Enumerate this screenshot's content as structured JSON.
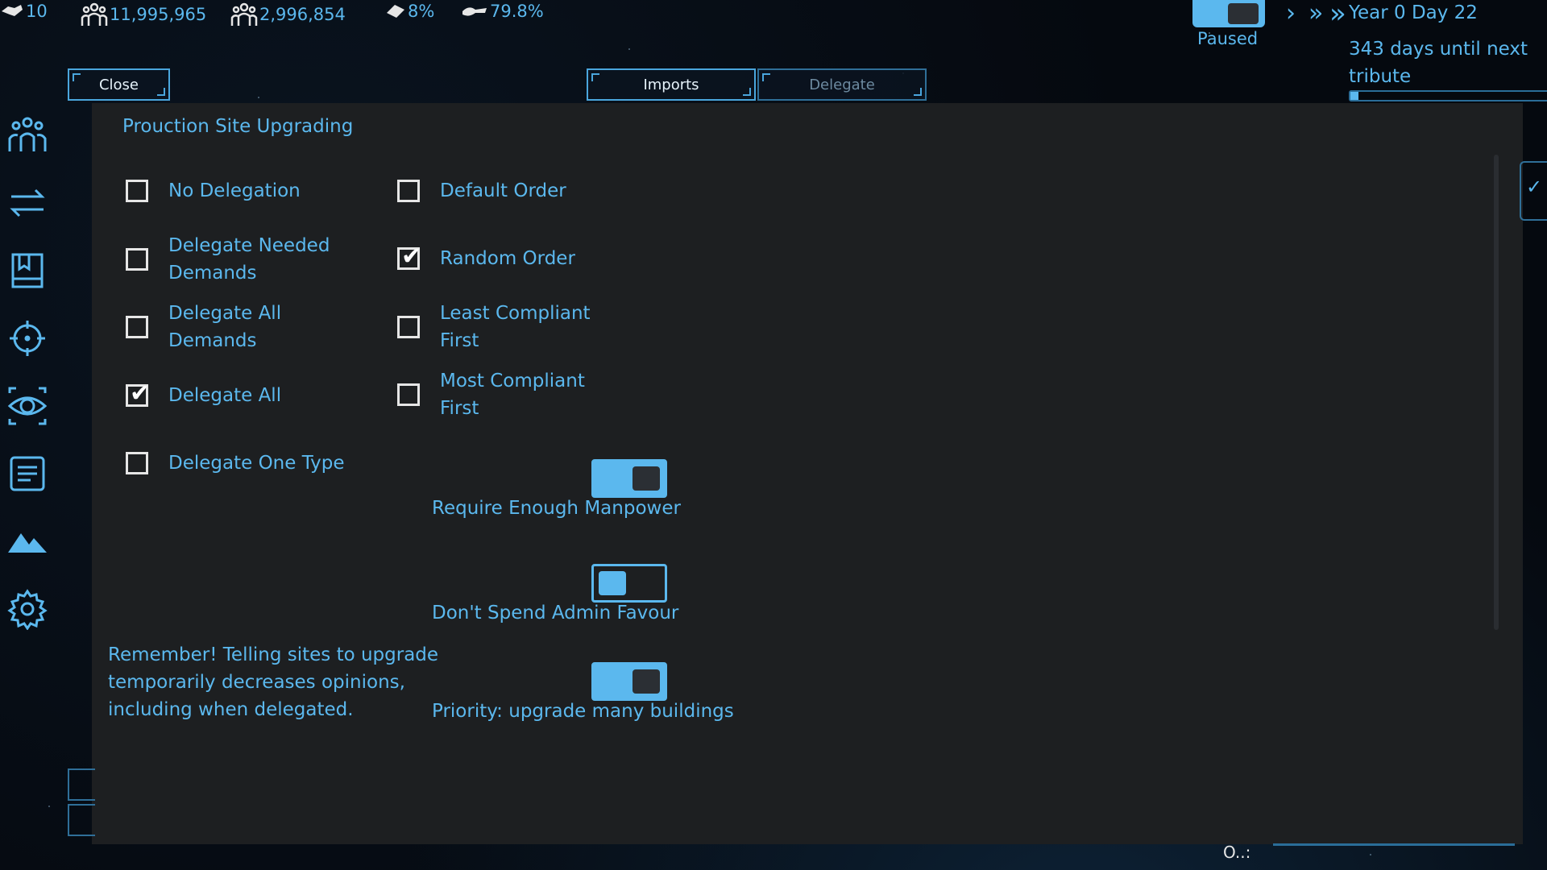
{
  "topbar": {
    "resources": [
      {
        "icon": "handshake-icon",
        "value": "10"
      },
      {
        "icon": "population-icon",
        "value": "11,995,965"
      },
      {
        "icon": "workforce-icon",
        "value": "2,996,854"
      },
      {
        "icon": "growth-icon",
        "value": "8%"
      },
      {
        "icon": "approval-icon",
        "value": "79.8%"
      }
    ],
    "paused_label": "Paused",
    "date": "Year 0 Day 22",
    "tribute": "343 days until next tribute",
    "tribute_progress": 0.04
  },
  "buttons": {
    "close": "Close",
    "imports": "Imports",
    "delegate": "Delegate"
  },
  "sidebar": [
    "people-icon",
    "trade-arrows-icon",
    "book-icon",
    "crosshair-icon",
    "eye-icon",
    "log-icon",
    "mountain-icon",
    "gear-icon"
  ],
  "panel": {
    "title": "Prouction Site Upgrading",
    "left_options": [
      {
        "label": "No Delegation",
        "checked": false
      },
      {
        "label": "Delegate Needed Demands",
        "checked": false
      },
      {
        "label": "Delegate All Demands",
        "checked": false
      },
      {
        "label": "Delegate All",
        "checked": true
      },
      {
        "label": "Delegate One Type",
        "checked": false
      }
    ],
    "right_options": [
      {
        "label": "Default Order",
        "checked": false
      },
      {
        "label": "Random Order",
        "checked": true
      },
      {
        "label": "Least Compliant First",
        "checked": false
      },
      {
        "label": "Most Compliant First",
        "checked": false
      }
    ],
    "toggles": [
      {
        "label": "Require Enough Manpower",
        "on": true
      },
      {
        "label": "Don't Spend Admin Favour",
        "on": false
      },
      {
        "label": "Priority: upgrade many buildings",
        "on": true
      }
    ],
    "reminder": "Remember! Telling sites to upgrade temporarily decreases opinions, including when delegated."
  },
  "bottom_status": "O..:",
  "colors": {
    "accent": "#5bb8ee",
    "panel": "#1d1f21",
    "background": "#060b12"
  }
}
